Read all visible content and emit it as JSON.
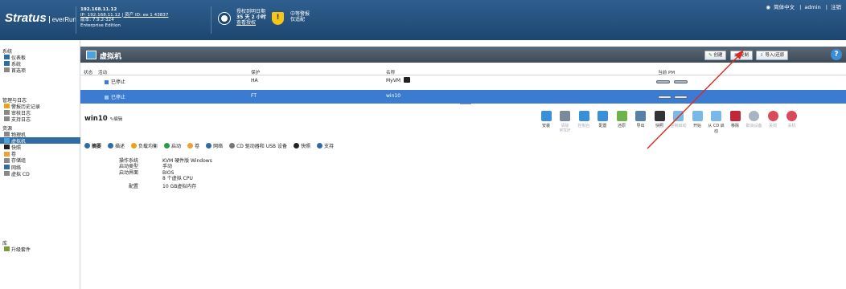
{
  "topbar": {
    "logo_main": "Stratus",
    "logo_sub": "everRun",
    "sys_ip": "192.168.11.12",
    "sys_line2": "IP: 192.168.11.12 | 资产 ID: ee 1 43837",
    "sys_version": "版本: 7.9.2-324",
    "sys_edition": "Enterprise Edition",
    "license_l1": "授权到明日期",
    "license_l2": "35 天 2 小时",
    "license_l3": "查看授权",
    "alarm_l1": "中等警报",
    "alarm_l2": "仅适配",
    "lang": "简体中文",
    "user": "admin",
    "logout": "注销"
  },
  "sidebar": {
    "groups": [
      "系统",
      "管理与日志",
      "资源",
      "库"
    ],
    "items": [
      {
        "label": "仪表板",
        "grp": 0
      },
      {
        "label": "系统",
        "grp": 0
      },
      {
        "label": "首选项",
        "grp": 0
      },
      {
        "label": "警报历史记录",
        "grp": 1
      },
      {
        "label": "审核日志",
        "grp": 1
      },
      {
        "label": "支持日志",
        "grp": 1
      },
      {
        "label": "物理机",
        "grp": 2
      },
      {
        "label": "虚拟机",
        "grp": 2,
        "selected": true
      },
      {
        "label": "快照",
        "grp": 2
      },
      {
        "label": "卷",
        "grp": 2
      },
      {
        "label": "存储组",
        "grp": 2
      },
      {
        "label": "网络",
        "grp": 2
      },
      {
        "label": "虚拟 CD",
        "grp": 2
      },
      {
        "label": "升级套件",
        "grp": 3
      }
    ]
  },
  "page": {
    "title": "虚拟机",
    "btn_create": "创建",
    "btn_copy": "复制",
    "btn_import": "导入/还原"
  },
  "table": {
    "headers": [
      "状态",
      "活动",
      "保护",
      "名称",
      "当前 PM"
    ],
    "rows": [
      {
        "state": "已停止",
        "protection": "HA",
        "name": "MyVM"
      },
      {
        "state": "已停止",
        "protection": "FT",
        "name": "win10"
      }
    ]
  },
  "detail": {
    "vm_name": "win10",
    "edit": "编辑"
  },
  "actions": [
    "安装",
    "清除 MTDF",
    "控制台",
    "配置",
    "还原",
    "导出",
    "快照",
    "强制启动",
    "开始",
    "从 CD 启动",
    "移除",
    "取消设备",
    "关闭",
    "关机"
  ],
  "tabs": [
    "摘要",
    "描述",
    "负载均衡",
    "启动",
    "卷",
    "网络",
    "CD 驱动器和 USB 设备",
    "快照",
    "支持"
  ],
  "summary": {
    "keys": [
      "操作系统",
      "启动类型",
      "启动界面",
      "",
      "配置"
    ],
    "values": [
      "KVM 硬件版 Windows",
      "手动",
      "BIOS",
      "8 个虚拟 CPU",
      "10 GB虚拟内存"
    ]
  }
}
